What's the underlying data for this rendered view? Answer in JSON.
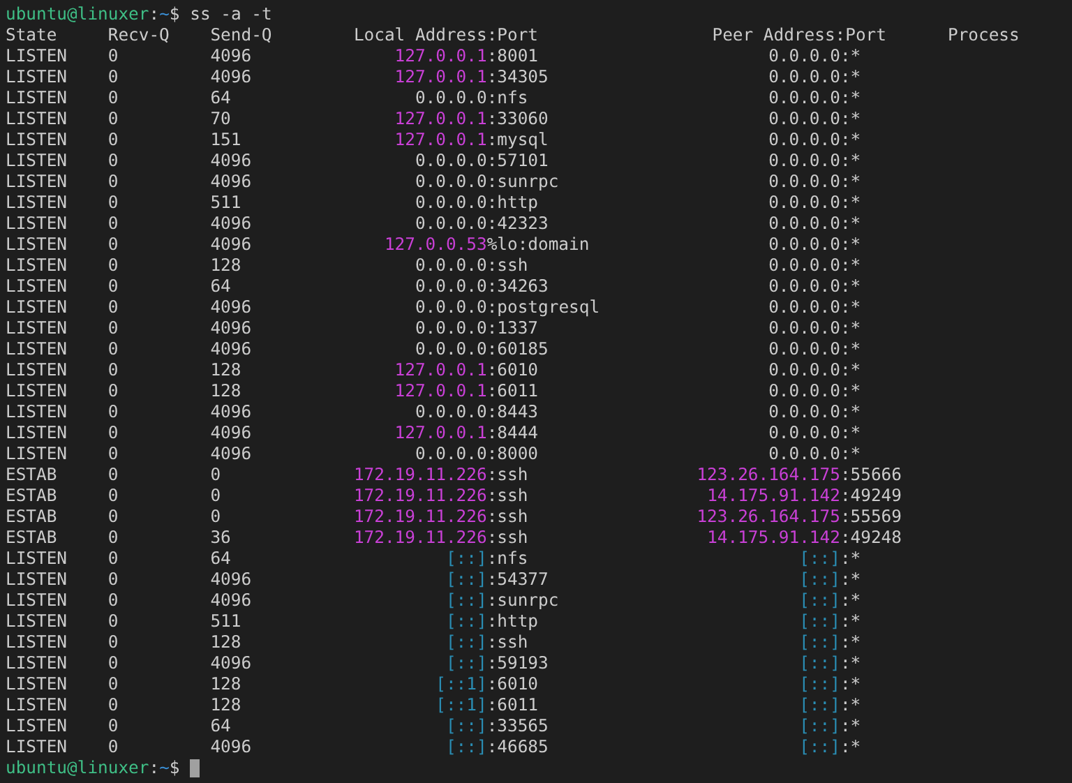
{
  "prompt_top": {
    "user_host": "ubuntu@linuxer",
    "separator": ":",
    "path": "~",
    "symbol": "$",
    "command": "ss -a -t"
  },
  "columns": [
    "State",
    "Recv-Q",
    "Send-Q",
    "Local Address:Port",
    "Peer Address:Port",
    "Process"
  ],
  "rows": [
    {
      "state": "LISTEN",
      "recv_q": "0",
      "send_q": "4096",
      "local": {
        "address": "127.0.0.1",
        "color": "#c940d6",
        "port": ":8001"
      },
      "peer": {
        "address": "0.0.0.0",
        "color": "#cccccc",
        "port": ":*"
      }
    },
    {
      "state": "LISTEN",
      "recv_q": "0",
      "send_q": "4096",
      "local": {
        "address": "127.0.0.1",
        "color": "#c940d6",
        "port": ":34305"
      },
      "peer": {
        "address": "0.0.0.0",
        "color": "#cccccc",
        "port": ":*"
      }
    },
    {
      "state": "LISTEN",
      "recv_q": "0",
      "send_q": "64",
      "local": {
        "address": "0.0.0.0",
        "color": "#cccccc",
        "port": ":nfs"
      },
      "peer": {
        "address": "0.0.0.0",
        "color": "#cccccc",
        "port": ":*"
      }
    },
    {
      "state": "LISTEN",
      "recv_q": "0",
      "send_q": "70",
      "local": {
        "address": "127.0.0.1",
        "color": "#c940d6",
        "port": ":33060"
      },
      "peer": {
        "address": "0.0.0.0",
        "color": "#cccccc",
        "port": ":*"
      }
    },
    {
      "state": "LISTEN",
      "recv_q": "0",
      "send_q": "151",
      "local": {
        "address": "127.0.0.1",
        "color": "#c940d6",
        "port": ":mysql"
      },
      "peer": {
        "address": "0.0.0.0",
        "color": "#cccccc",
        "port": ":*"
      }
    },
    {
      "state": "LISTEN",
      "recv_q": "0",
      "send_q": "4096",
      "local": {
        "address": "0.0.0.0",
        "color": "#cccccc",
        "port": ":57101"
      },
      "peer": {
        "address": "0.0.0.0",
        "color": "#cccccc",
        "port": ":*"
      }
    },
    {
      "state": "LISTEN",
      "recv_q": "0",
      "send_q": "4096",
      "local": {
        "address": "0.0.0.0",
        "color": "#cccccc",
        "port": ":sunrpc"
      },
      "peer": {
        "address": "0.0.0.0",
        "color": "#cccccc",
        "port": ":*"
      }
    },
    {
      "state": "LISTEN",
      "recv_q": "0",
      "send_q": "511",
      "local": {
        "address": "0.0.0.0",
        "color": "#cccccc",
        "port": ":http"
      },
      "peer": {
        "address": "0.0.0.0",
        "color": "#cccccc",
        "port": ":*"
      }
    },
    {
      "state": "LISTEN",
      "recv_q": "0",
      "send_q": "4096",
      "local": {
        "address": "0.0.0.0",
        "color": "#cccccc",
        "port": ":42323"
      },
      "peer": {
        "address": "0.0.0.0",
        "color": "#cccccc",
        "port": ":*"
      }
    },
    {
      "state": "LISTEN",
      "recv_q": "0",
      "send_q": "4096",
      "local": {
        "address": "127.0.0.53",
        "color": "#c940d6",
        "port": "%lo:domain"
      },
      "peer": {
        "address": "0.0.0.0",
        "color": "#cccccc",
        "port": ":*"
      }
    },
    {
      "state": "LISTEN",
      "recv_q": "0",
      "send_q": "128",
      "local": {
        "address": "0.0.0.0",
        "color": "#cccccc",
        "port": ":ssh"
      },
      "peer": {
        "address": "0.0.0.0",
        "color": "#cccccc",
        "port": ":*"
      }
    },
    {
      "state": "LISTEN",
      "recv_q": "0",
      "send_q": "64",
      "local": {
        "address": "0.0.0.0",
        "color": "#cccccc",
        "port": ":34263"
      },
      "peer": {
        "address": "0.0.0.0",
        "color": "#cccccc",
        "port": ":*"
      }
    },
    {
      "state": "LISTEN",
      "recv_q": "0",
      "send_q": "4096",
      "local": {
        "address": "0.0.0.0",
        "color": "#cccccc",
        "port": ":postgresql"
      },
      "peer": {
        "address": "0.0.0.0",
        "color": "#cccccc",
        "port": ":*"
      }
    },
    {
      "state": "LISTEN",
      "recv_q": "0",
      "send_q": "4096",
      "local": {
        "address": "0.0.0.0",
        "color": "#cccccc",
        "port": ":1337"
      },
      "peer": {
        "address": "0.0.0.0",
        "color": "#cccccc",
        "port": ":*"
      }
    },
    {
      "state": "LISTEN",
      "recv_q": "0",
      "send_q": "4096",
      "local": {
        "address": "0.0.0.0",
        "color": "#cccccc",
        "port": ":60185"
      },
      "peer": {
        "address": "0.0.0.0",
        "color": "#cccccc",
        "port": ":*"
      }
    },
    {
      "state": "LISTEN",
      "recv_q": "0",
      "send_q": "128",
      "local": {
        "address": "127.0.0.1",
        "color": "#c940d6",
        "port": ":6010"
      },
      "peer": {
        "address": "0.0.0.0",
        "color": "#cccccc",
        "port": ":*"
      }
    },
    {
      "state": "LISTEN",
      "recv_q": "0",
      "send_q": "128",
      "local": {
        "address": "127.0.0.1",
        "color": "#c940d6",
        "port": ":6011"
      },
      "peer": {
        "address": "0.0.0.0",
        "color": "#cccccc",
        "port": ":*"
      }
    },
    {
      "state": "LISTEN",
      "recv_q": "0",
      "send_q": "4096",
      "local": {
        "address": "0.0.0.0",
        "color": "#cccccc",
        "port": ":8443"
      },
      "peer": {
        "address": "0.0.0.0",
        "color": "#cccccc",
        "port": ":*"
      }
    },
    {
      "state": "LISTEN",
      "recv_q": "0",
      "send_q": "4096",
      "local": {
        "address": "127.0.0.1",
        "color": "#c940d6",
        "port": ":8444"
      },
      "peer": {
        "address": "0.0.0.0",
        "color": "#cccccc",
        "port": ":*"
      }
    },
    {
      "state": "LISTEN",
      "recv_q": "0",
      "send_q": "4096",
      "local": {
        "address": "0.0.0.0",
        "color": "#cccccc",
        "port": ":8000"
      },
      "peer": {
        "address": "0.0.0.0",
        "color": "#cccccc",
        "port": ":*"
      }
    },
    {
      "state": "ESTAB",
      "recv_q": "0",
      "send_q": "0",
      "local": {
        "address": "172.19.11.226",
        "color": "#c940d6",
        "port": ":ssh"
      },
      "peer": {
        "address": "123.26.164.175",
        "color": "#c940d6",
        "port": ":55666"
      }
    },
    {
      "state": "ESTAB",
      "recv_q": "0",
      "send_q": "0",
      "local": {
        "address": "172.19.11.226",
        "color": "#c940d6",
        "port": ":ssh"
      },
      "peer": {
        "address": "14.175.91.142",
        "color": "#c940d6",
        "port": ":49249"
      }
    },
    {
      "state": "ESTAB",
      "recv_q": "0",
      "send_q": "0",
      "local": {
        "address": "172.19.11.226",
        "color": "#c940d6",
        "port": ":ssh"
      },
      "peer": {
        "address": "123.26.164.175",
        "color": "#c940d6",
        "port": ":55569"
      }
    },
    {
      "state": "ESTAB",
      "recv_q": "0",
      "send_q": "36",
      "local": {
        "address": "172.19.11.226",
        "color": "#c940d6",
        "port": ":ssh"
      },
      "peer": {
        "address": "14.175.91.142",
        "color": "#c940d6",
        "port": ":49248"
      }
    },
    {
      "state": "LISTEN",
      "recv_q": "0",
      "send_q": "64",
      "local": {
        "address": "[::]",
        "color": "#2a8db3",
        "port": ":nfs"
      },
      "peer": {
        "address": "[::]",
        "color": "#2a8db3",
        "port": ":*"
      }
    },
    {
      "state": "LISTEN",
      "recv_q": "0",
      "send_q": "4096",
      "local": {
        "address": "[::]",
        "color": "#2a8db3",
        "port": ":54377"
      },
      "peer": {
        "address": "[::]",
        "color": "#2a8db3",
        "port": ":*"
      }
    },
    {
      "state": "LISTEN",
      "recv_q": "0",
      "send_q": "4096",
      "local": {
        "address": "[::]",
        "color": "#2a8db3",
        "port": ":sunrpc"
      },
      "peer": {
        "address": "[::]",
        "color": "#2a8db3",
        "port": ":*"
      }
    },
    {
      "state": "LISTEN",
      "recv_q": "0",
      "send_q": "511",
      "local": {
        "address": "[::]",
        "color": "#2a8db3",
        "port": ":http"
      },
      "peer": {
        "address": "[::]",
        "color": "#2a8db3",
        "port": ":*"
      }
    },
    {
      "state": "LISTEN",
      "recv_q": "0",
      "send_q": "128",
      "local": {
        "address": "[::]",
        "color": "#2a8db3",
        "port": ":ssh"
      },
      "peer": {
        "address": "[::]",
        "color": "#2a8db3",
        "port": ":*"
      }
    },
    {
      "state": "LISTEN",
      "recv_q": "0",
      "send_q": "4096",
      "local": {
        "address": "[::]",
        "color": "#2a8db3",
        "port": ":59193"
      },
      "peer": {
        "address": "[::]",
        "color": "#2a8db3",
        "port": ":*"
      }
    },
    {
      "state": "LISTEN",
      "recv_q": "0",
      "send_q": "128",
      "local": {
        "address": "[::1]",
        "color": "#2a8db3",
        "port": ":6010"
      },
      "peer": {
        "address": "[::]",
        "color": "#2a8db3",
        "port": ":*"
      }
    },
    {
      "state": "LISTEN",
      "recv_q": "0",
      "send_q": "128",
      "local": {
        "address": "[::1]",
        "color": "#2a8db3",
        "port": ":6011"
      },
      "peer": {
        "address": "[::]",
        "color": "#2a8db3",
        "port": ":*"
      }
    },
    {
      "state": "LISTEN",
      "recv_q": "0",
      "send_q": "64",
      "local": {
        "address": "[::]",
        "color": "#2a8db3",
        "port": ":33565"
      },
      "peer": {
        "address": "[::]",
        "color": "#2a8db3",
        "port": ":*"
      }
    },
    {
      "state": "LISTEN",
      "recv_q": "0",
      "send_q": "4096",
      "local": {
        "address": "[::]",
        "color": "#2a8db3",
        "port": ":46685"
      },
      "peer": {
        "address": "[::]",
        "color": "#2a8db3",
        "port": ":*"
      }
    }
  ],
  "prompt_bottom": {
    "user_host": "ubuntu@linuxer",
    "separator": ":",
    "path": "~",
    "symbol": "$"
  }
}
